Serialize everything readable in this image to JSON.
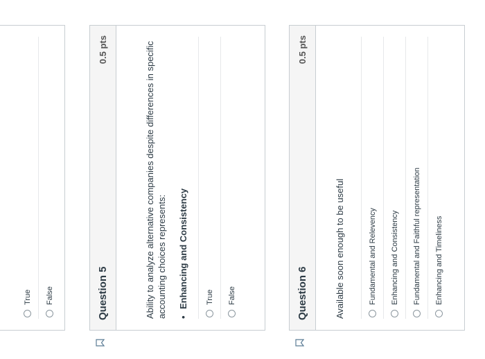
{
  "previous_question": {
    "answers": [
      "True",
      "False"
    ]
  },
  "question5": {
    "title": "Question 5",
    "points": "0.5 pts",
    "text": "Ability to analyze alternative companies despite differences in specific accounting choices represents:",
    "bullet": "Enhancing and Consistency",
    "answers": [
      "True",
      "False"
    ]
  },
  "question6": {
    "title": "Question 6",
    "points": "0.5 pts",
    "text": "Available soon enough to be useful",
    "answers": [
      "Fundamental and Relevency",
      "Enhancing and Consistency",
      "Fundamental and Faithful representation",
      "Enhancing and Timeliness"
    ]
  },
  "icons": {
    "flag": "bookmark-flag-icon"
  }
}
